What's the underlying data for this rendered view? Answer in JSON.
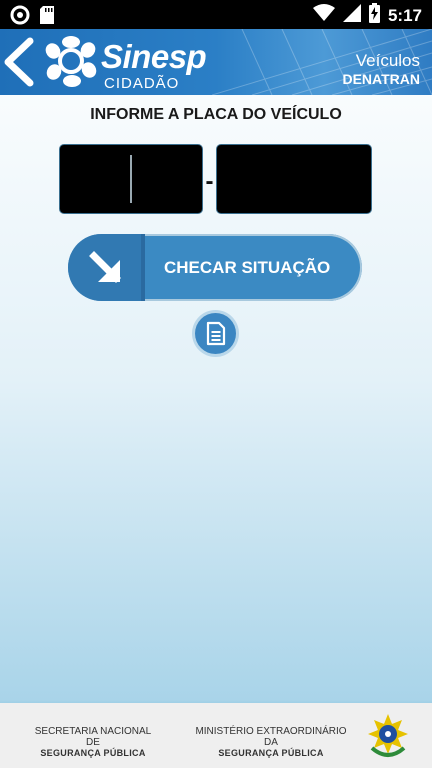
{
  "status_bar": {
    "time": "5:17",
    "left_icons": [
      "circle-notification-icon",
      "sd-card-icon"
    ],
    "right_icons": [
      "wifi-icon",
      "signal-icon",
      "battery-charging-icon"
    ]
  },
  "header": {
    "app_name": "Sinesp",
    "app_subtitle": "CIDADÃO",
    "section_title": "Veículos",
    "section_subtitle": "DENATRAN",
    "icons": [
      "back-arrow-icon",
      "sinesp-logo-icon"
    ]
  },
  "main": {
    "prompt": "INFORME A PLACA DO VEÍCULO",
    "plate_letters": {
      "value": "",
      "placeholder": ""
    },
    "plate_separator": "-",
    "plate_numbers": {
      "value": "",
      "placeholder": ""
    },
    "check_button_label": "CHECAR SITUAÇÃO",
    "check_button_icon": "arrow-down-right-icon",
    "doc_button_icon": "document-icon"
  },
  "footer": {
    "left_line1": "SECRETARIA NACIONAL DE",
    "left_line2": "SEGURANÇA PÚBLICA",
    "right_line1": "MINISTÉRIO EXTRAORDINÁRIO DA",
    "right_line2": "SEGURANÇA PÚBLICA",
    "emblem_icon": "brazil-coat-of-arms-icon"
  },
  "colors": {
    "header_blue": "#2b7fc6",
    "button_blue": "#3b8ac3",
    "plate_black": "#000000"
  }
}
